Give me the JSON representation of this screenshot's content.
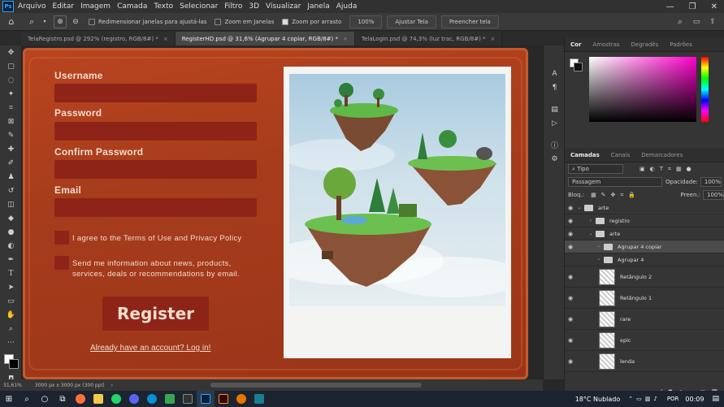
{
  "menu": {
    "app_logo": "Ps",
    "items": [
      "Arquivo",
      "Editar",
      "Imagem",
      "Camada",
      "Texto",
      "Selecionar",
      "Filtro",
      "3D",
      "Visualizar",
      "Janela",
      "Ajuda"
    ],
    "window_buttons": [
      "—",
      "❐",
      "✕"
    ]
  },
  "options": {
    "resize_windows": "Redimensionar janelas para ajustá-las",
    "zoom_all": "Zoom em Janelas",
    "scrubby_zoom": "Zoom por arrasto",
    "zoom_value": "100%",
    "fit_screen": "Ajustar Tela",
    "fill_screen": "Preencher tela"
  },
  "tabs": [
    {
      "label": "TelaRegistro.psd @ 292% (registro, RGB/8#) *",
      "active": false
    },
    {
      "label": "RegisterHD.psd @ 31,6% (Agrupar 4 copiar, RGB/8#) *",
      "active": true
    },
    {
      "label": "TelaLogin.psd @ 74,3% (luz trac, RGB/8#) *",
      "active": false
    }
  ],
  "form": {
    "username_label": "Username",
    "password_label": "Password",
    "confirm_label": "Confirm Password",
    "email_label": "Email",
    "terms_text": "I agree to the Terms of Use and Privacy Policy",
    "news_line1": "Send me information about news, products,",
    "news_line2": "services, deals or recommendations by email.",
    "register": "Register",
    "login_link": "Already have an account? Log in!"
  },
  "statusbar": {
    "zoom": "31,61%",
    "doc_size": "3000 px x 3000 px (300 ppi)"
  },
  "panel_tabs_color": [
    {
      "label": "Cor",
      "active": true
    },
    {
      "label": "Amostras",
      "active": false
    },
    {
      "label": "Degradês",
      "active": false
    },
    {
      "label": "Padrões",
      "active": false
    }
  ],
  "panel_tabs_layers": [
    {
      "label": "Camadas",
      "active": true
    },
    {
      "label": "Canais",
      "active": false
    },
    {
      "label": "Demarcadores",
      "active": false
    }
  ],
  "layers_panel": {
    "filter_kind": "Tipo",
    "blend_mode": "Passagem",
    "opacity_label": "Opacidade:",
    "opacity_value": "100%",
    "lock_label": "Bloq.:",
    "fill_label": "Preen.:",
    "fill_value": "100%"
  },
  "layers": [
    {
      "name": "arte",
      "type": "group",
      "indent": 0,
      "expanded": true
    },
    {
      "name": "registro",
      "type": "group",
      "indent": 1,
      "expanded": false
    },
    {
      "name": "arte",
      "type": "group",
      "indent": 1,
      "expanded": true
    },
    {
      "name": "Agrupar 4 copiar",
      "type": "group",
      "indent": 2,
      "expanded": false,
      "selected": true
    },
    {
      "name": "Agrupar 4",
      "type": "group",
      "indent": 2,
      "expanded": false
    },
    {
      "name": "Retângulo 2",
      "type": "layer",
      "indent": 2
    },
    {
      "name": "Retângulo 1",
      "type": "layer",
      "indent": 2
    },
    {
      "name": "rare",
      "type": "layer",
      "indent": 2
    },
    {
      "name": "epic",
      "type": "layer",
      "indent": 2
    },
    {
      "name": "lenda",
      "type": "layer",
      "indent": 2
    }
  ],
  "taskbar": {
    "weather": "18°C  Nublado",
    "language": "POR",
    "time": "00:09"
  },
  "colors": {
    "accent": "#31a8ff",
    "form_bg": "#a63c1c",
    "field_bg": "#8e2417"
  }
}
